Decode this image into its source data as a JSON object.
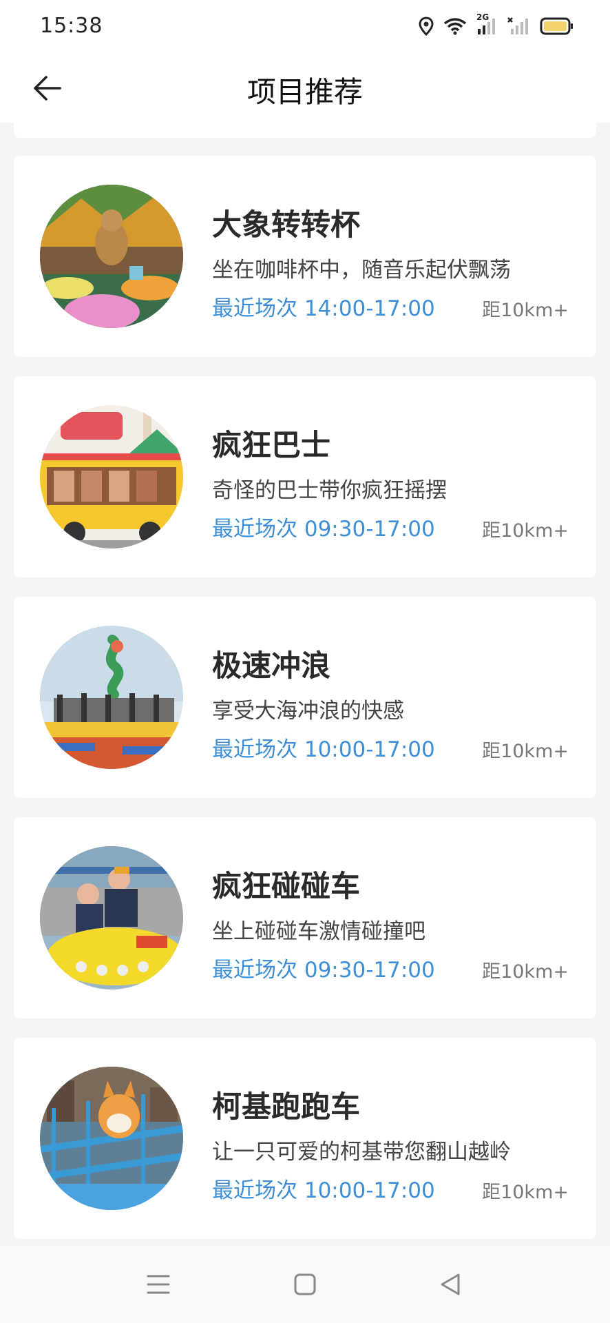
{
  "status_bar": {
    "time": "15:38",
    "signal_label": "2G",
    "icons": [
      "location-icon",
      "wifi-icon",
      "signal-icon",
      "signal-off-icon",
      "battery-icon"
    ]
  },
  "navbar": {
    "title": "项目推荐",
    "back_icon": "arrow-left-icon"
  },
  "items": [
    {
      "title": "大象转转杯",
      "desc": "坐在咖啡杯中，随音乐起伏飘荡",
      "session": "最近场次 14:00-17:00",
      "distance": "距10km+"
    },
    {
      "title": "疯狂巴士",
      "desc": "奇怪的巴士带你疯狂摇摆",
      "session": "最近场次 09:30-17:00",
      "distance": "距10km+"
    },
    {
      "title": "极速冲浪",
      "desc": "享受大海冲浪的快感",
      "session": "最近场次 10:00-17:00",
      "distance": "距10km+"
    },
    {
      "title": "疯狂碰碰车",
      "desc": "坐上碰碰车激情碰撞吧",
      "session": "最近场次 09:30-17:00",
      "distance": "距10km+"
    },
    {
      "title": "柯基跑跑车",
      "desc": "让一只可爱的柯基带您翻山越岭",
      "session": "最近场次 10:00-17:00",
      "distance": "距10km+"
    }
  ],
  "bottom_nav": {
    "icons": [
      "menu-icon",
      "home-icon",
      "back-triangle-icon"
    ]
  },
  "colors": {
    "accent_blue": "#3f8fd6",
    "background": "#f4f5f7",
    "card": "#ffffff"
  }
}
